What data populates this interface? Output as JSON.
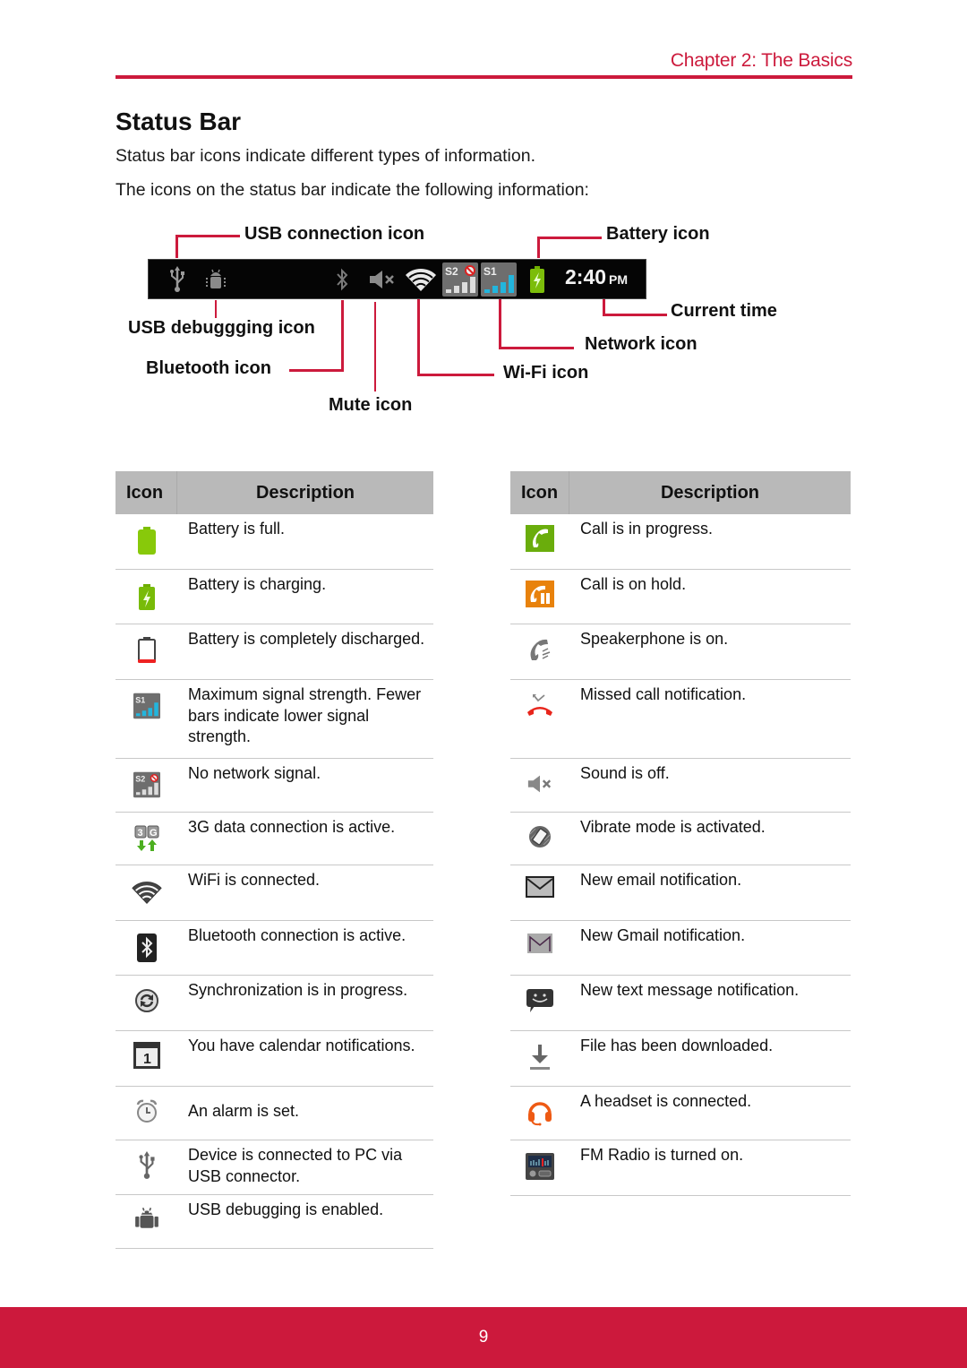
{
  "header": {
    "chapter": "Chapter 2: The Basics",
    "accent_color": "#cc1a3c"
  },
  "section": {
    "title": "Status Bar",
    "intro_1": "Status bar icons indicate different types of information.",
    "intro_2": "The icons on the status bar indicate the following information:"
  },
  "diagram": {
    "status_bar_time": "2:40",
    "status_bar_ampm": "PM",
    "callouts": {
      "usb_connection": "USB connection icon",
      "battery": "Battery icon",
      "current_time": "Current time",
      "usb_debugging": "USB debuggging icon",
      "network": "Network icon",
      "bluetooth": "Bluetooth icon",
      "wifi": "Wi-Fi icon",
      "mute": "Mute icon"
    }
  },
  "tables": {
    "left": {
      "columns": [
        "Icon",
        "Description"
      ],
      "rows": [
        {
          "icon": "battery-full-icon",
          "description": "Battery is full."
        },
        {
          "icon": "battery-charging-icon",
          "description": "Battery is charging."
        },
        {
          "icon": "battery-empty-icon",
          "description": "Battery is completely discharged."
        },
        {
          "icon": "signal-max-icon",
          "description": "Maximum signal strength. Fewer bars indicate lower signal strength."
        },
        {
          "icon": "no-signal-icon",
          "description": "No network signal."
        },
        {
          "icon": "3g-data-icon",
          "description": "3G data connection is active."
        },
        {
          "icon": "wifi-icon",
          "description": "WiFi is connected."
        },
        {
          "icon": "bluetooth-icon",
          "description": "Bluetooth connection is active."
        },
        {
          "icon": "sync-icon",
          "description": "Synchronization is in progress."
        },
        {
          "icon": "calendar-icon",
          "description": "You have calendar notifications."
        },
        {
          "icon": "alarm-icon",
          "description": "An alarm is set."
        },
        {
          "icon": "usb-icon",
          "description": "Device is connected to PC via USB connector."
        },
        {
          "icon": "android-debug-icon",
          "description": "USB debugging is enabled."
        }
      ]
    },
    "right": {
      "columns": [
        "Icon",
        "Description"
      ],
      "rows": [
        {
          "icon": "call-in-progress-icon",
          "description": "Call is in progress."
        },
        {
          "icon": "call-on-hold-icon",
          "description": "Call is on hold."
        },
        {
          "icon": "speakerphone-icon",
          "description": "Speakerphone is on."
        },
        {
          "icon": "missed-call-icon",
          "description": "Missed call notification."
        },
        {
          "icon": "sound-off-icon",
          "description": "Sound is off."
        },
        {
          "icon": "vibrate-icon",
          "description": "Vibrate mode is activated."
        },
        {
          "icon": "email-icon",
          "description": "New email notification."
        },
        {
          "icon": "gmail-icon",
          "description": "New Gmail notification."
        },
        {
          "icon": "text-message-icon",
          "description": "New text message notification."
        },
        {
          "icon": "download-icon",
          "description": "File has been downloaded."
        },
        {
          "icon": "headset-icon",
          "description": "A headset is connected."
        },
        {
          "icon": "fm-radio-icon",
          "description": "FM Radio is turned on."
        }
      ]
    }
  },
  "footer": {
    "page_number": "9",
    "color": "#cc193c"
  }
}
